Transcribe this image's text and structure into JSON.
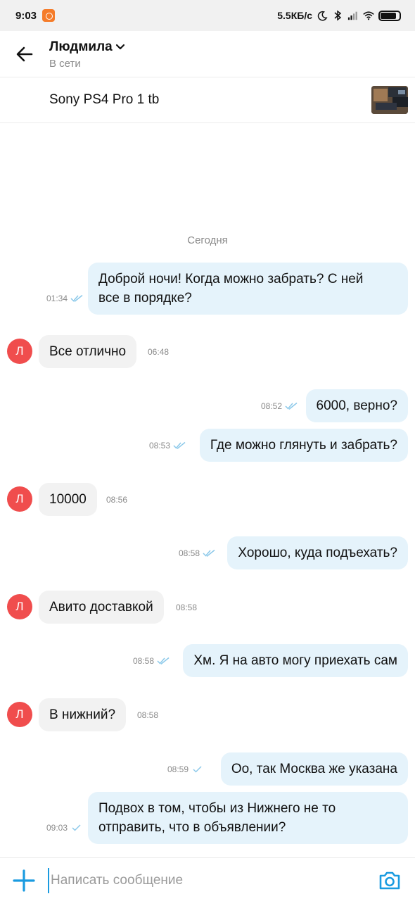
{
  "status_bar": {
    "time": "9:03",
    "speed": "5.5КБ/с",
    "icons": [
      "app-notification-icon",
      "moon-icon",
      "bluetooth-icon",
      "signal-icon",
      "wifi-icon",
      "battery-icon"
    ]
  },
  "header": {
    "name": "Людмила",
    "status": "В сети"
  },
  "listing": {
    "title": "Sony PS4 Pro 1 tb"
  },
  "date_separator": "Сегодня",
  "messages": [
    {
      "dir": "out",
      "text_lines": [
        "Доброй ночи! Когда можно забрать? С ней",
        "все в порядке?"
      ],
      "time": "01:34",
      "ticks": "double"
    },
    {
      "dir": "in",
      "avatar": "Л",
      "text": "Все отлично",
      "time": "06:48"
    },
    {
      "dir": "out",
      "text": "6000, верно?",
      "time": "08:52",
      "ticks": "double"
    },
    {
      "dir": "out",
      "text": "Где можно глянуть и забрать?",
      "time": "08:53",
      "ticks": "double"
    },
    {
      "dir": "in",
      "avatar": "Л",
      "text": "10000",
      "time": "08:56"
    },
    {
      "dir": "out",
      "text": "Хорошо, куда подъехать?",
      "time": "08:58",
      "ticks": "double"
    },
    {
      "dir": "in",
      "avatar": "Л",
      "text": "Авито доставкой",
      "time": "08:58"
    },
    {
      "dir": "out",
      "text": "Хм. Я на авто могу приехать сам",
      "time": "08:58",
      "ticks": "double"
    },
    {
      "dir": "in",
      "avatar": "Л",
      "text": "В нижний?",
      "time": "08:58"
    },
    {
      "dir": "out",
      "text": "Оо, так Москва же указана",
      "time": "08:59",
      "ticks": "single"
    },
    {
      "dir": "out",
      "text_lines": [
        "Подвох в том, чтобы из Нижнего не то",
        "отправить, что в объявлении?"
      ],
      "time": "09:03",
      "ticks": "single"
    }
  ],
  "composer": {
    "placeholder": "Написать сообщение"
  },
  "colors": {
    "outgoing_bubble": "#e5f3fb",
    "incoming_bubble": "#f2f2f2",
    "avatar": "#f04d4d",
    "accent": "#1a9be0"
  }
}
